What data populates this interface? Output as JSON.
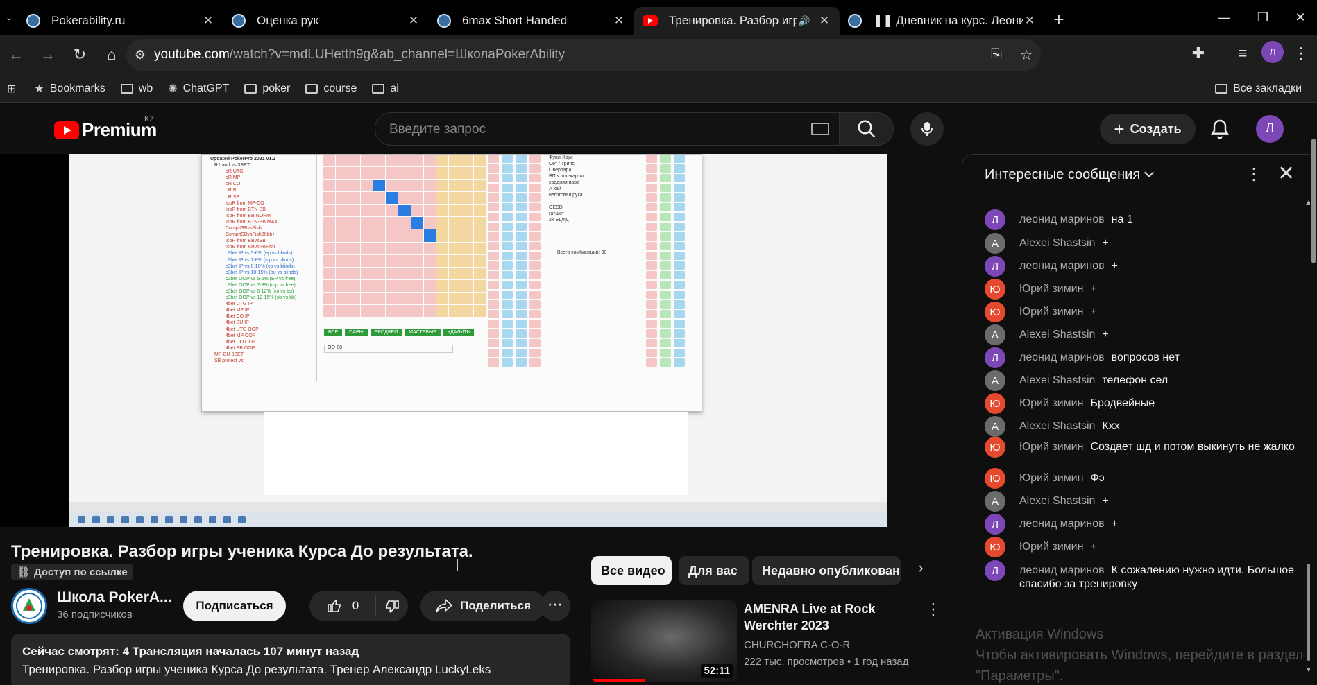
{
  "browser": {
    "tabs": [
      {
        "title": "Pokerability.ru",
        "favicon": "globe-icon",
        "active": false
      },
      {
        "title": "Оценка рук",
        "favicon": "globe-icon",
        "active": false
      },
      {
        "title": "6max Short Handed",
        "favicon": "globe-icon",
        "active": false
      },
      {
        "title": "Тренировка. Разбор игры",
        "favicon": "youtube-icon",
        "active": true
      },
      {
        "title": "❚❚ Дневник на курс. Леонид - ",
        "favicon": "globe-icon",
        "active": false
      }
    ],
    "url_host": "youtube.com",
    "url_path": "/watch?v=mdLUHetth9g&ab_channel=ШколаPokerAbility",
    "profile_initial": "Л",
    "bookmarks": [
      {
        "label": "Bookmarks",
        "icon": "star-icon"
      },
      {
        "label": "wb",
        "icon": "folder-icon"
      },
      {
        "label": "ChatGPT",
        "icon": "chatgpt-icon"
      },
      {
        "label": "poker",
        "icon": "folder-icon"
      },
      {
        "label": "course",
        "icon": "folder-icon"
      },
      {
        "label": "ai",
        "icon": "folder-icon"
      }
    ],
    "all_bookmarks": "Все закладки"
  },
  "youtube": {
    "logo_text": "Premium",
    "country": "KZ",
    "search_placeholder": "Введите запрос",
    "create_label": "Создать",
    "avatar_initial": "Л"
  },
  "video": {
    "title": "Тренировка. Разбор игры ученика Курса До результата.",
    "visibility": "Доступ по ссылке",
    "channel": "Школа PokerA...",
    "subscribers": "36 подписчиков",
    "subscribe_label": "Подписаться",
    "likes": "0",
    "share_label": "Поделиться",
    "desc_line1": "Сейчас смотрят: 4  Трансляция началась 107 минут назад",
    "desc_line2": "Тренировка. Разбор игры ученика Курса До результата. Тренер Александр LuckyLeks"
  },
  "chat": {
    "title": "Интересные сообщения",
    "messages": [
      {
        "author": "леонид маринов",
        "text": "на 1",
        "initial": "Л",
        "color": "#7e47b8"
      },
      {
        "author": "Alexei Shastsin",
        "text": "+",
        "initial": "A",
        "color": "#6b6b6b"
      },
      {
        "author": "леонид маринов",
        "text": "+",
        "initial": "Л",
        "color": "#7e47b8"
      },
      {
        "author": "Юрий зимин",
        "text": "+",
        "initial": "Ю",
        "color": "#e5492e"
      },
      {
        "author": "Юрий зимин",
        "text": "+",
        "initial": "Ю",
        "color": "#e5492e"
      },
      {
        "author": "Alexei Shastsin",
        "text": "+",
        "initial": "A",
        "color": "#6b6b6b"
      },
      {
        "author": "леонид маринов",
        "text": "вопросов нет",
        "initial": "Л",
        "color": "#7e47b8"
      },
      {
        "author": "Alexei Shastsin",
        "text": "телефон сел",
        "initial": "A",
        "color": "#6b6b6b"
      },
      {
        "author": "Юрий зимин",
        "text": "Бродвейные",
        "initial": "Ю",
        "color": "#e5492e"
      },
      {
        "author": "Alexei Shastsin",
        "text": "Кхх",
        "initial": "A",
        "color": "#6b6b6b"
      },
      {
        "author": "Юрий зимин",
        "text": "Создает шд и потом выкинуть не жалко",
        "initial": "Ю",
        "color": "#e5492e"
      },
      {
        "author": "Юрий зимин",
        "text": "Фэ",
        "initial": "Ю",
        "color": "#e5492e"
      },
      {
        "author": "Alexei Shastsin",
        "text": "+",
        "initial": "A",
        "color": "#6b6b6b"
      },
      {
        "author": "леонид маринов",
        "text": "+",
        "initial": "Л",
        "color": "#7e47b8"
      },
      {
        "author": "Юрий зимин",
        "text": "+",
        "initial": "Ю",
        "color": "#e5492e"
      },
      {
        "author": "леонид маринов",
        "text": "К сожалению нужно идти. Большое спасибо за тренировку",
        "initial": "Л",
        "color": "#7e47b8"
      }
    ],
    "watermark_line1": "Активация Windows",
    "watermark_line2": "Чтобы активировать Windows, перейдите в раздел",
    "watermark_line3": "\"Параметры\"."
  },
  "chips": [
    "Все видео",
    "Для вас",
    "Недавно опубликованн"
  ],
  "recommendation": {
    "title": "AMENRA Live at Rock Werchter 2023",
    "channel": "CHURCHOFRA C-O-R",
    "views": "222 тыс. просмотров",
    "age": "1 год назад",
    "duration": "52:11",
    "watched_fraction": 0.37
  },
  "player_screen": {
    "tree_title": "Updated PokerPro 2021 v1.2",
    "tree_items": [
      "R1 and vs 3BET",
      "oR UTG",
      "oR MP",
      "oR CO",
      "oR BU",
      "oR SB",
      "IsoR from MP-CO",
      "IsoR from BTN-BB",
      "IsoR from BB NORM",
      "IsoR from BTN-BB MAX",
      "CompltSBvsFish",
      "CompltSBvsFish30bb+",
      "IsoR from BBvsSB",
      "IsoR from BBvsSBFish",
      "c3bet IP vs 5-6% (ep vs blinds)",
      "c3bet IP vs 7-8% (mp vs blinds)",
      "c3bet IP vs 8-10% (co vs blinds)",
      "c3bet IP vs 10-15% (bu vs blinds)",
      "c3bet OOP vs 5-6% (EP vs free)",
      "c3bet OOP vs 7-8% (mp vs free)",
      "c3bet OOP vs 8-12% (co vs bu)",
      "c3bet OOP vs 12-15% (sb vs bb)",
      "4bet UTG IP",
      "4bet MP IP",
      "4bet CO IP",
      "4bet BU IP",
      "4bet UTG OOP",
      "4bet MP OOP",
      "4bet CO OOP",
      "4bet SB OOP",
      "MP-BU 3BET",
      "SB protect vs"
    ],
    "filters": [
      "Фулл-Хаус",
      "Сет / Трипс",
      "Оверпара",
      "ВП < топ-карты",
      "средняя пара",
      "А хай",
      "неготовая рука",
      "",
      "OESD",
      "гатшот",
      "2х БДФД"
    ],
    "combos_text": "Всего комбинаций: 30",
    "buttons": [
      "ВСЕ",
      "ПАРЫ",
      "БРОДВЕЙ",
      "МАСТЕВЫЕ",
      "УДАЛИТЬ"
    ],
    "range_label": "QQ-88"
  }
}
